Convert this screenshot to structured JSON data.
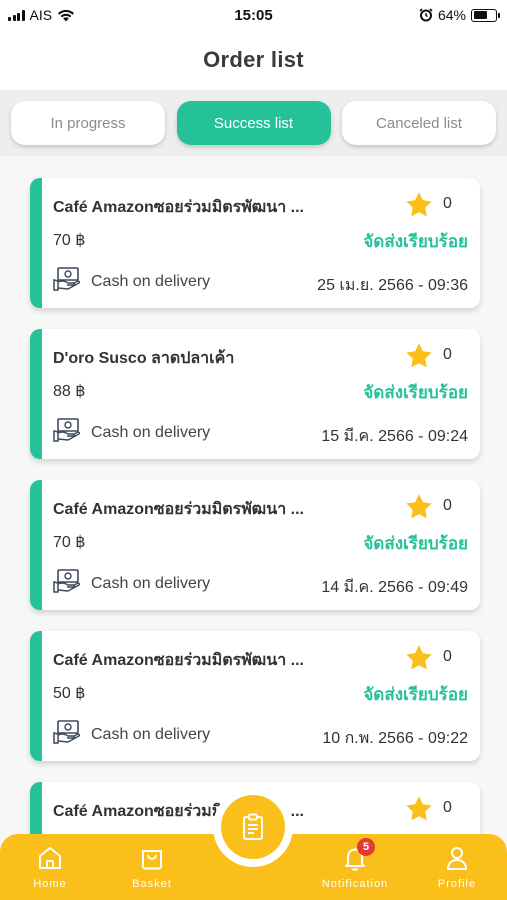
{
  "status_bar": {
    "carrier": "AIS",
    "time": "15:05",
    "battery": "64%",
    "battery_level": 0.64
  },
  "header": {
    "title": "Order list"
  },
  "tabs": [
    {
      "label": "In progress",
      "active": false
    },
    {
      "label": "Success list",
      "active": true
    },
    {
      "label": "Canceled list",
      "active": false
    }
  ],
  "orders": [
    {
      "shop": "Café Amazonซอยร่วมมิตรพัฒนา ...",
      "rating": "0",
      "price": "70 ฿",
      "status": "จัดส่งเรียบร้อย",
      "payment": "Cash on delivery",
      "date": "25 เม.ย. 2566 - 09:36"
    },
    {
      "shop": "D'oro Susco ลาดปลาเค้า",
      "rating": "0",
      "price": "88 ฿",
      "status": "จัดส่งเรียบร้อย",
      "payment": "Cash on delivery",
      "date": "15 มี.ค. 2566 - 09:24"
    },
    {
      "shop": "Café Amazonซอยร่วมมิตรพัฒนา ...",
      "rating": "0",
      "price": "70 ฿",
      "status": "จัดส่งเรียบร้อย",
      "payment": "Cash on delivery",
      "date": "14 มี.ค. 2566 - 09:49"
    },
    {
      "shop": "Café Amazonซอยร่วมมิตรพัฒนา ...",
      "rating": "0",
      "price": "50 ฿",
      "status": "จัดส่งเรียบร้อย",
      "payment": "Cash on delivery",
      "date": "10 ก.พ. 2566 - 09:22"
    },
    {
      "shop": "Café Amazonซอยร่วมมิตรพัฒนา ...",
      "rating": "0",
      "price": "",
      "status": "",
      "payment": "",
      "date": ""
    }
  ],
  "nav": {
    "home": "Home",
    "basket": "Basket",
    "notification": "Notification",
    "notification_badge": "5",
    "profile": "Profile"
  },
  "colors": {
    "accent": "#25c29a",
    "nav": "#fbbf1c",
    "star": "#fbbf1c",
    "badge": "#e53935"
  }
}
